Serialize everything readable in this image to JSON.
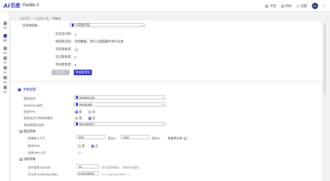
{
  "brand": {
    "logo_mark": "AI",
    "name_cn": "百度",
    "name_en": "Paddle X"
  },
  "topbar": {
    "docs_label": "文档",
    "help_label": "帮助",
    "settings_label": "设置",
    "avatar_text": "IM"
  },
  "sidebar": {
    "items": [
      {
        "label": "项目"
      },
      {
        "label": "数据"
      },
      {
        "label": "训练"
      },
      {
        "label": "评估"
      },
      {
        "label": "发布"
      },
      {
        "label": "模型"
      },
      {
        "label": "设置"
      }
    ]
  },
  "breadcrumb": {
    "root": "全部项目",
    "project": "小度猫分类",
    "task": "T0023",
    "separator": "/"
  },
  "dataset": {
    "label": "选择数据集：",
    "selected": "小度猫分类",
    "fields": [
      {
        "label": "标签类别数：",
        "value": "1"
      },
      {
        "label": "数据集说明：",
        "value": "示例数据，用于小度猫图片进行分类"
      },
      {
        "label": "训练集数量：",
        "value": "14"
      },
      {
        "label": "验证集数量：",
        "value": "2"
      },
      {
        "label": "测试集数量：",
        "value": "3"
      }
    ],
    "next_button": "下一步",
    "preview_button": "数据集预览"
  },
  "params": {
    "section_title": "参数配置",
    "model_type_label": "模型选择",
    "model_type_value": "MaskRCNN",
    "backbone_label": "Backbone选择",
    "backbone_value": "ResNet50",
    "fpn_label": "使用FPN",
    "fpn_yes": "是",
    "fpn_no": "否",
    "custom_pretrain_label": "使用自定义预训练模型",
    "pretrain_select_label": "预训练模型选择",
    "pretrain_value": "IMAGENET",
    "model_params_head": "模型参数",
    "image_size_label": "图像输入尺寸",
    "width_value": "800",
    "width_unit": "宽(px)",
    "height_value": "1333",
    "height_unit": "高(px)",
    "keep_ratio_label": "图像等比例",
    "use_gpu_label": "使用GPU",
    "gpu_yes": "是",
    "gpu_no": "否",
    "gpu_select_label": "选择GPU卡号",
    "gpu_select_value": "0,1",
    "train_params_head": "训练参数",
    "epoch_label": "迭代轮数 (Epoch)",
    "epoch_value": "12",
    "epoch_note": "迭代轮数越多，训练时间越长",
    "lr_label": "学习率 (Learning Rate)",
    "lr_value": "0.00125000",
    "lr_note": "0 < Learning Rate < 1"
  }
}
